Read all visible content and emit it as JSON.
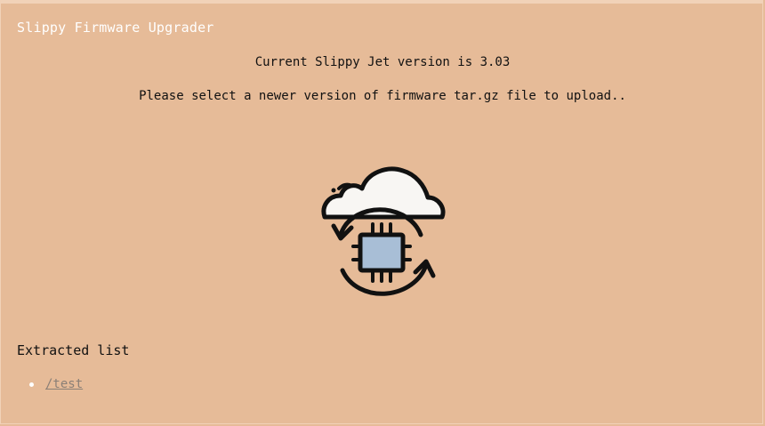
{
  "page": {
    "title": "Slippy Firmware Upgrader",
    "version_text": "Current Slippy Jet version is 3.03",
    "instruction_text": "Please select a newer version of firmware tar.gz file to upload.."
  },
  "upload": {
    "icon": "cloud-firmware-upload-icon"
  },
  "extracted": {
    "heading": "Extracted list",
    "items": [
      {
        "label": "/test"
      }
    ]
  },
  "colors": {
    "background": "#e6bb98",
    "title_text": "#ffffff",
    "body_text": "#111111",
    "chip_fill": "#a8bed6",
    "cloud_fill": "#f8f6f3",
    "link": "#8a7f76"
  }
}
